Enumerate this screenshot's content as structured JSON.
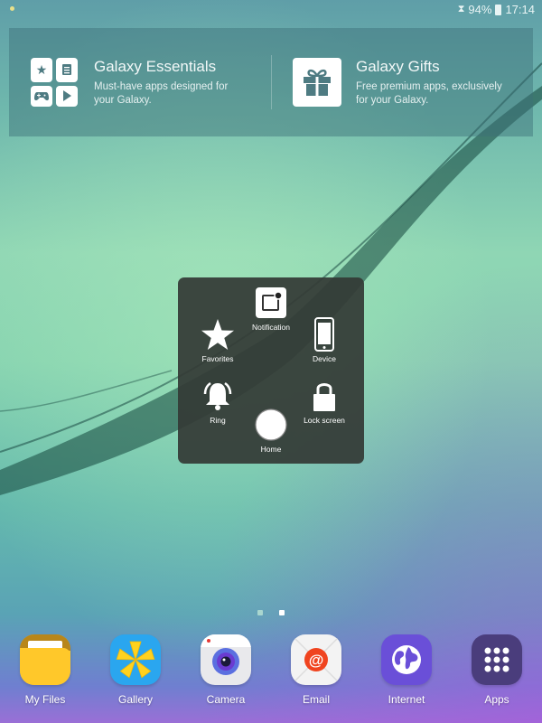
{
  "status_bar": {
    "battery_percent": "94%",
    "time": "17:14",
    "icons": [
      "notification-dot-icon",
      "wifi-signal-icon",
      "battery-icon"
    ]
  },
  "promo_banner": {
    "cards": [
      {
        "title": "Galaxy Essentials",
        "description": "Must-have apps designed for your Galaxy.",
        "icon": "galaxy-essentials-icon",
        "tiles": [
          "star-icon",
          "document-icon",
          "gamepad-icon",
          "play-icon"
        ]
      },
      {
        "title": "Galaxy Gifts",
        "description": "Free premium apps, exclusively for your Galaxy.",
        "icon": "gift-icon"
      }
    ]
  },
  "assistant_menu": {
    "items": [
      {
        "label": "Notification",
        "icon": "notification-icon"
      },
      {
        "label": "Favorites",
        "icon": "star-icon"
      },
      {
        "label": "Device",
        "icon": "phone-device-icon"
      },
      {
        "label": "Ring",
        "icon": "bell-icon"
      },
      {
        "label": "Lock screen",
        "icon": "lock-icon"
      },
      {
        "label": "Home",
        "icon": "home-circle-icon"
      }
    ]
  },
  "pager": {
    "pages": 2,
    "current_page": 2,
    "colors": {
      "inactive": "#a9d6cf",
      "active": "#ffffff"
    }
  },
  "dock": {
    "apps": [
      {
        "label": "My Files",
        "icon": "folder-icon",
        "color": "#ffc82a"
      },
      {
        "label": "Gallery",
        "icon": "gallery-flower-icon",
        "color": "#2aa6ef"
      },
      {
        "label": "Camera",
        "icon": "camera-icon",
        "color": "#e9e9ec"
      },
      {
        "label": "Email",
        "icon": "email-at-icon",
        "color": "#f3f3f3"
      },
      {
        "label": "Internet",
        "icon": "globe-icon",
        "color": "#6a4fd8"
      },
      {
        "label": "Apps",
        "icon": "apps-grid-icon",
        "color": "#4a3d7c"
      }
    ]
  }
}
